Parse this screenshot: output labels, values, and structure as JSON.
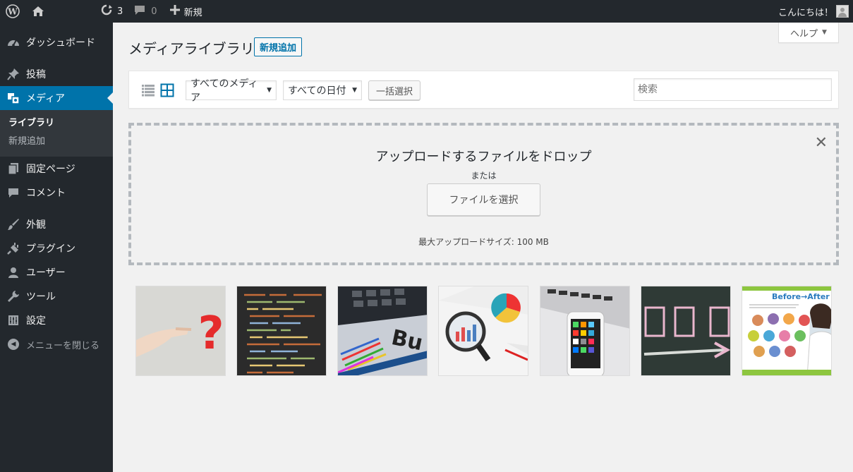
{
  "adminbar": {
    "updates_count": "3",
    "comments_count": "0",
    "new_label": "新規",
    "greeting": "こんにちは！"
  },
  "sidebar": {
    "items": [
      {
        "label": "ダッシュボード",
        "icon": "dashboard-icon"
      },
      {
        "label": "投稿",
        "icon": "pin-icon"
      },
      {
        "label": "メディア",
        "icon": "media-icon"
      },
      {
        "label": "固定ページ",
        "icon": "page-icon"
      },
      {
        "label": "コメント",
        "icon": "comment-icon"
      },
      {
        "label": "外観",
        "icon": "brush-icon"
      },
      {
        "label": "プラグイン",
        "icon": "plugin-icon"
      },
      {
        "label": "ユーザー",
        "icon": "user-icon"
      },
      {
        "label": "ツール",
        "icon": "wrench-icon"
      },
      {
        "label": "設定",
        "icon": "settings-icon"
      }
    ],
    "submenu": [
      "ライブラリ",
      "新規追加"
    ],
    "collapse_label": "メニューを閉じる"
  },
  "header": {
    "title": "メディアライブラリ",
    "add_new": "新規追加",
    "help": "ヘルプ"
  },
  "toolbar": {
    "type_filter": "すべてのメディア",
    "date_filter": "すべての日付",
    "bulk_select": "一括選択",
    "search_placeholder": "検索"
  },
  "uploader": {
    "drop_text": "アップロードするファイルをドロップ",
    "or_text": "または",
    "select_button": "ファイルを選択",
    "max_size": "最大アップロードサイズ: 100 MB"
  },
  "thumbnails": [
    {
      "name": "thumbnail-pointing-question"
    },
    {
      "name": "thumbnail-code-screen"
    },
    {
      "name": "thumbnail-calculator-business"
    },
    {
      "name": "thumbnail-magnifier-chart"
    },
    {
      "name": "thumbnail-smartphone-laptop"
    },
    {
      "name": "thumbnail-chalkboard-boxes"
    },
    {
      "name": "thumbnail-before-after-flyer",
      "title_text": "Before→After"
    }
  ],
  "colors": {
    "adminbar_bg": "#23282d",
    "accent": "#0073aa",
    "page_bg": "#f1f1f1"
  }
}
